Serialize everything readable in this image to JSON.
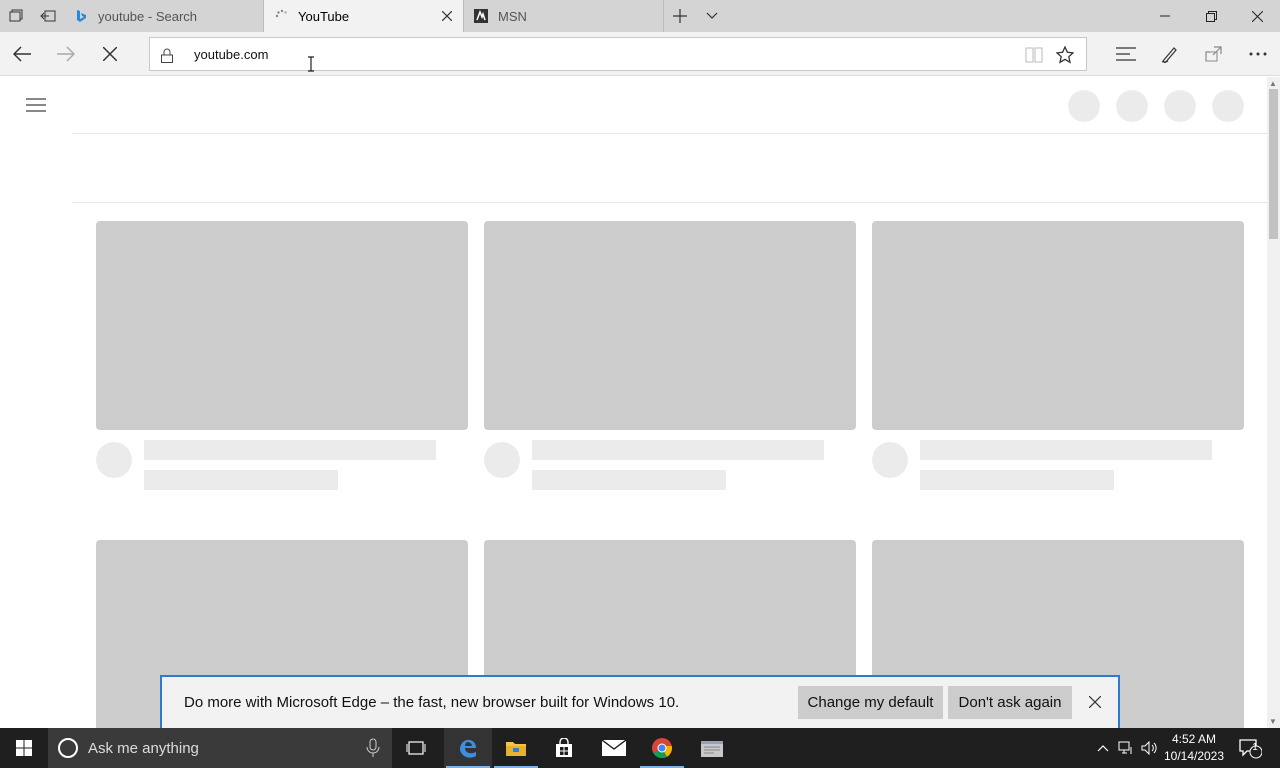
{
  "browser": {
    "tabs": [
      {
        "title": "youtube - Search",
        "active": false
      },
      {
        "title": "YouTube",
        "active": true
      },
      {
        "title": "MSN",
        "active": false
      }
    ],
    "address": "youtube.com"
  },
  "notification": {
    "message": "Do more with Microsoft Edge – the fast, new browser built for Windows 10.",
    "change_default_label": "Change my default",
    "dont_ask_label": "Don't ask again"
  },
  "taskbar": {
    "search_placeholder": "Ask me anything",
    "apps": [
      "edge-icon",
      "file-explorer-icon",
      "store-icon",
      "mail-icon",
      "chrome-icon",
      "app-icon"
    ],
    "time": "4:52 AM",
    "date": "10/14/2023",
    "notification_count": "1"
  },
  "colors": {
    "accent": "#2b7bd0",
    "placeholder_thumb": "#cccccc",
    "placeholder_line": "#ebebeb",
    "taskbar": "#1f1f1f"
  }
}
